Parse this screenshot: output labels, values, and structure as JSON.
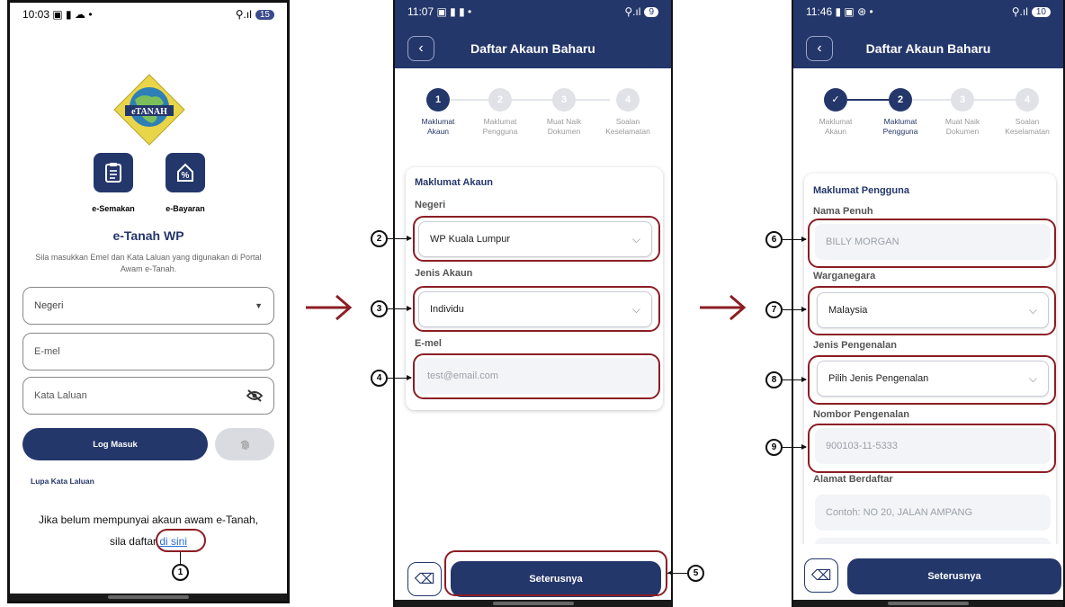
{
  "screen1": {
    "status": {
      "time": "10:03",
      "left_icons": "▣ ▮ ☁ •",
      "signal": "⚲.ıl",
      "battery": "15"
    },
    "logo_text": "eTANAH",
    "tiles": [
      {
        "label": "e-Semakan",
        "icon": "clipboard-icon"
      },
      {
        "label": "e-Bayaran",
        "icon": "percent-tag-icon"
      }
    ],
    "title": "e-Tanah WP",
    "subtitle": "Sila masukkan Emel dan Kata Laluan yang digunakan di Portal Awam e-Tanah.",
    "negeri_placeholder": "Negeri",
    "email_placeholder": "E-mel",
    "password_placeholder": "Kata Laluan",
    "login_label": "Log Masuk",
    "forgot_label": "Lupa Kata Laluan",
    "register_prefix": "Jika belum mempunyai akaun awam e-Tanah,",
    "register_sila": "sila daftar",
    "register_link": "di sini",
    "callout": "1"
  },
  "screen2": {
    "status": {
      "time": "11:07",
      "left_icons": "▣ ▮ ▮ •",
      "signal": "⚲.ıl",
      "battery": "9"
    },
    "header_title": "Daftar Akaun Baharu",
    "steps": [
      {
        "num": "1",
        "label1": "Maklumat",
        "label2": "Akaun"
      },
      {
        "num": "2",
        "label1": "Maklumat",
        "label2": "Pengguna"
      },
      {
        "num": "3",
        "label1": "Muat Naik",
        "label2": "Dokumen"
      },
      {
        "num": "4",
        "label1": "Soalan",
        "label2": "Keselamatan"
      }
    ],
    "section_title": "Maklumat Akaun",
    "negeri_label": "Negeri",
    "negeri_value": "WP Kuala Lumpur",
    "jenis_label": "Jenis Akaun",
    "jenis_value": "Individu",
    "email_label": "E-mel",
    "email_placeholder": "test@email.com",
    "next_label": "Seterusnya",
    "callouts": [
      "2",
      "3",
      "4",
      "5"
    ]
  },
  "screen3": {
    "status": {
      "time": "11:46",
      "left_icons": "▮ ▣ ⊛ •",
      "signal": "⚲.ıl",
      "battery": "10"
    },
    "header_title": "Daftar Akaun Baharu",
    "steps": [
      {
        "num": "✓",
        "label1": "Maklumat",
        "label2": "Akaun"
      },
      {
        "num": "2",
        "label1": "Maklumat",
        "label2": "Pengguna"
      },
      {
        "num": "3",
        "label1": "Muat Naik",
        "label2": "Dokumen"
      },
      {
        "num": "4",
        "label1": "Soalan",
        "label2": "Keselamatan"
      }
    ],
    "section_title": "Maklumat Pengguna",
    "nama_label": "Nama Penuh",
    "nama_placeholder": "BILLY MORGAN",
    "warga_label": "Warganegara",
    "warga_value": "Malaysia",
    "pengenalan_label": "Jenis Pengenalan",
    "pengenalan_value": "Pilih Jenis Pengenalan",
    "nombor_label": "Nombor Pengenalan",
    "nombor_placeholder": "900103-11-5333",
    "alamat_label": "Alamat Berdaftar",
    "alamat_placeholder": "Contoh: NO 20, JALAN AMPANG",
    "next_label": "Seterusnya",
    "callouts": [
      "6",
      "7",
      "8",
      "9"
    ]
  },
  "colors": {
    "primary": "#24376b",
    "highlight": "#8b1e24",
    "arrow": "#8b1e24"
  }
}
